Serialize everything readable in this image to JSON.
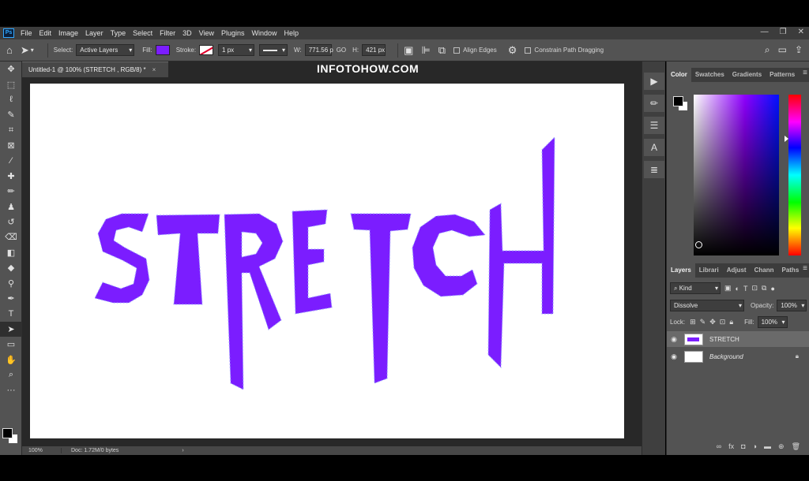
{
  "app": {
    "logo": "Ps"
  },
  "menu": [
    "File",
    "Edit",
    "Image",
    "Layer",
    "Type",
    "Select",
    "Filter",
    "3D",
    "View",
    "Plugins",
    "Window",
    "Help"
  ],
  "window_controls": {
    "minimize": "—",
    "restore": "❐",
    "close": "✕"
  },
  "options": {
    "select_label": "Select:",
    "select_value": "Active Layers",
    "fill_label": "Fill:",
    "fill_color": "#7b1dff",
    "stroke_label": "Stroke:",
    "stroke_width": "1 px",
    "w_label": "W:",
    "w_value": "771.56 p",
    "link_label": "GO",
    "h_label": "H:",
    "h_value": "421 px",
    "align_edges": "Align Edges",
    "constrain": "Constrain Path Dragging"
  },
  "document": {
    "tab_title": "Untitled-1 @ 100% (STRETCH , RGB/8) *",
    "close": "×",
    "watermark": "INFOTOHOW.COM",
    "canvas_text": "STRETCH",
    "text_color": "#7b1dff",
    "zoom": "100%",
    "doc_info": "Doc: 1.72M/0 bytes",
    "status_arrow": "›"
  },
  "color_panel": {
    "tabs": [
      "Color",
      "Swatches",
      "Gradients",
      "Patterns"
    ],
    "menu": "≡"
  },
  "layers_panel": {
    "tabs": [
      "Layers",
      "Librari",
      "Adjust",
      "Chann",
      "Paths"
    ],
    "menu": "≡",
    "kind": "Kind",
    "blend_mode": "Dissolve",
    "opacity_label": "Opacity:",
    "opacity_value": "100%",
    "lock_label": "Lock:",
    "fill_label": "Fill:",
    "fill_value": "100%",
    "layers": [
      {
        "name": "STRETCH",
        "selected": true
      },
      {
        "name": "Background",
        "selected": false
      }
    ]
  }
}
